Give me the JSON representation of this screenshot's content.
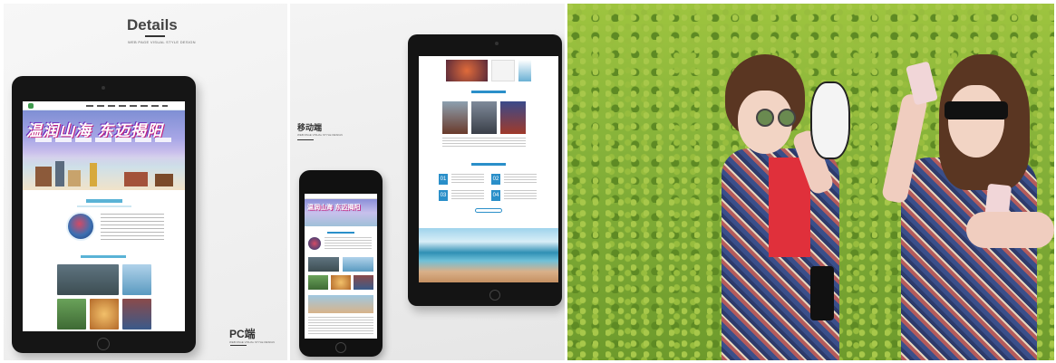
{
  "details_panel": {
    "title": "Details",
    "subtitle": "WEB PAGE VISUAL STYLE DESIGN",
    "pc_label": "PC端",
    "pc_subtitle": "WEB PAGE VISUAL STYLE DESIGN",
    "banner_slogan": "温润山海  东迈揭阳"
  },
  "mobile_panel": {
    "mobile_label": "移动端",
    "mobile_subtitle": "WEB PAGE VISUAL STYLE DESIGN",
    "phone_slogan": "温润山海 东迈揭阳",
    "numbers": [
      "01",
      "02",
      "03",
      "04"
    ]
  },
  "colors": {
    "accent_blue": "#2a8fc9",
    "banner_purple": "#8b8fd8",
    "slogan_pink": "#c21f7c"
  }
}
